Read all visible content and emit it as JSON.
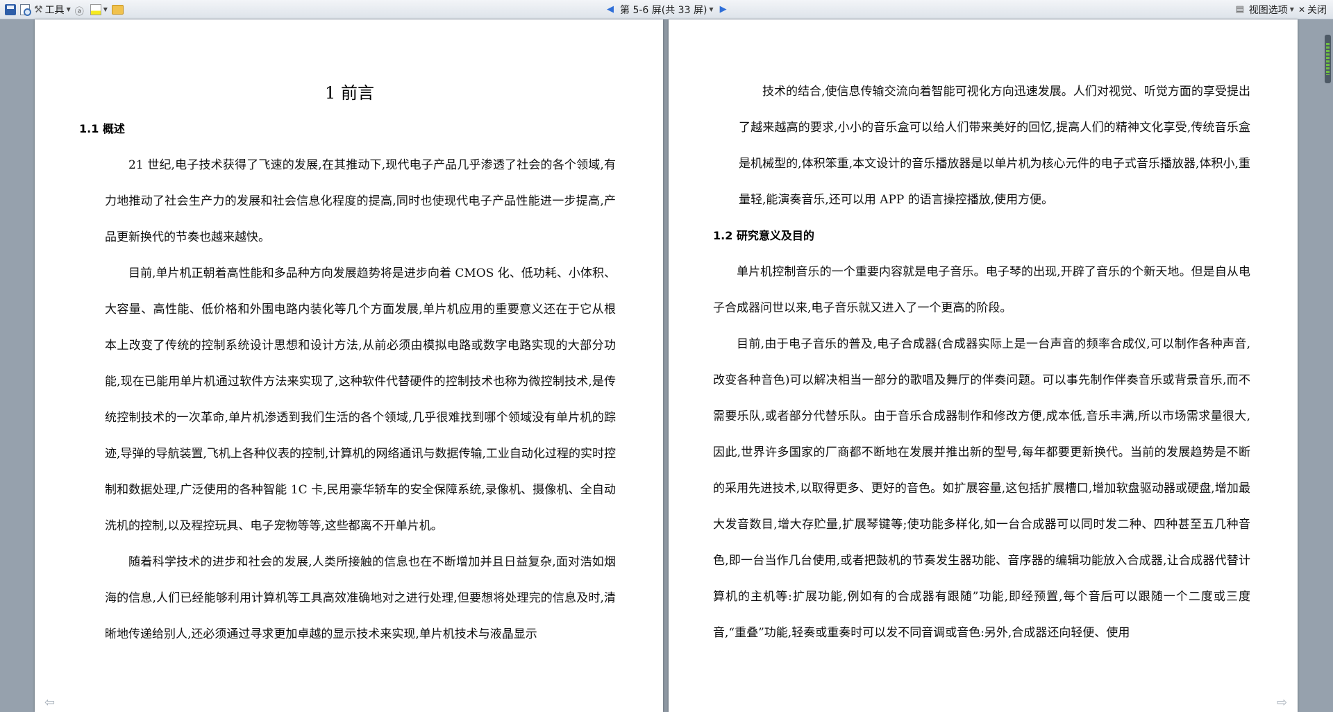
{
  "toolbar": {
    "tools_label": "工具",
    "page_indicator": "第 5-6 屏(共 33 屏)",
    "view_options_label": "视图选项",
    "close_label": "关闭"
  },
  "left_page": {
    "chapter_title": "1 前言",
    "section_heading": "1.1 概述",
    "paragraphs": [
      "21 世纪,电子技术获得了飞速的发展,在其推动下,现代电子产品几乎渗透了社会的各个领域,有力地推动了社会生产力的发展和社会信息化程度的提高,同时也使现代电子产品性能进一步提高,产品更新换代的节奏也越来越快。",
      "目前,单片机正朝着高性能和多品种方向发展趋势将是进步向着 CMOS 化、低功耗、小体积、大容量、高性能、低价格和外围电路内装化等几个方面发展,单片机应用的重要意义还在于它从根本上改变了传统的控制系统设计思想和设计方法,从前必须由模拟电路或数字电路实现的大部分功能,现在已能用单片机通过软件方法来实现了,这种软件代替硬件的控制技术也称为微控制技术,是传统控制技术的一次革命,单片机渗透到我们生活的各个领域,几乎很难找到哪个领域没有单片机的踪迹,导弹的导航装置,飞机上各种仪表的控制,计算机的网络通讯与数据传输,工业自动化过程的实时控制和数据处理,广泛使用的各种智能 1C 卡,民用豪华轿车的安全保障系统,录像机、摄像机、全自动洗机的控制,以及程控玩具、电子宠物等等,这些都离不开单片机。",
      "随着科学技术的进步和社会的发展,人类所接触的信息也在不断增加并且日益复杂,面对浩如烟海的信息,人们已经能够利用计算机等工具高效准确地对之进行处理,但要想将处理完的信息及时,清晰地传递给别人,还必须通过寻求更加卓越的显示技术来实现,单片机技术与液晶显示"
    ]
  },
  "right_page": {
    "continued_paragraph": "技术的结合,使信息传输交流向着智能可视化方向迅速发展。人们对视觉、听觉方面的享受提出了越来越高的要求,小小的音乐盒可以给人们带来美好的回忆,提高人们的精神文化享受,传统音乐盒是机械型的,体积笨重,本文设计的音乐播放器是以单片机为核心元件的电子式音乐播放器,体积小,重量轻,能演奏音乐,还可以用 APP 的语言操控播放,使用方便。",
    "section_heading": "1.2 研究意义及目的",
    "paragraphs": [
      "单片机控制音乐的一个重要内容就是电子音乐。电子琴的出现,开辟了音乐的个新天地。但是自从电子合成器问世以来,电子音乐就又进入了一个更高的阶段。",
      "目前,由于电子音乐的普及,电子合成器(合成器实际上是一台声音的频率合成仪,可以制作各种声音,改变各种音色)可以解决相当一部分的歌唱及舞厅的伴奏问题。可以事先制作伴奏音乐或背景音乐,而不需要乐队,或者部分代替乐队。由于音乐合成器制作和修改方便,成本低,音乐丰满,所以市场需求量很大,因此,世界许多国家的厂商都不断地在发展并推出新的型号,每年都要更新换代。当前的发展趋势是不断的采用先进技术,以取得更多、更好的音色。如扩展容量,这包括扩展槽口,增加软盘驱动器或硬盘,增加最大发音数目,增大存贮量,扩展琴键等;使功能多样化,如一台合成器可以同时发二种、四种甚至五几种音色,即一台当作几台使用,或者把鼓机的节奏发生器功能、音序器的编辑功能放入合成器,让合成器代替计算机的主机等:扩展功能,例如有的合成器有跟随”功能,即经预置,每个音后可以跟随一个二度或三度音,“重叠”功能,轻奏或重奏时可以发不同音调或音色:另外,合成器还向轻便、使用"
    ]
  },
  "icons": {
    "prev_page": "◀",
    "next_page": "▶",
    "page_back": "⇦",
    "page_forward": "⇨",
    "close_x": "✕"
  }
}
